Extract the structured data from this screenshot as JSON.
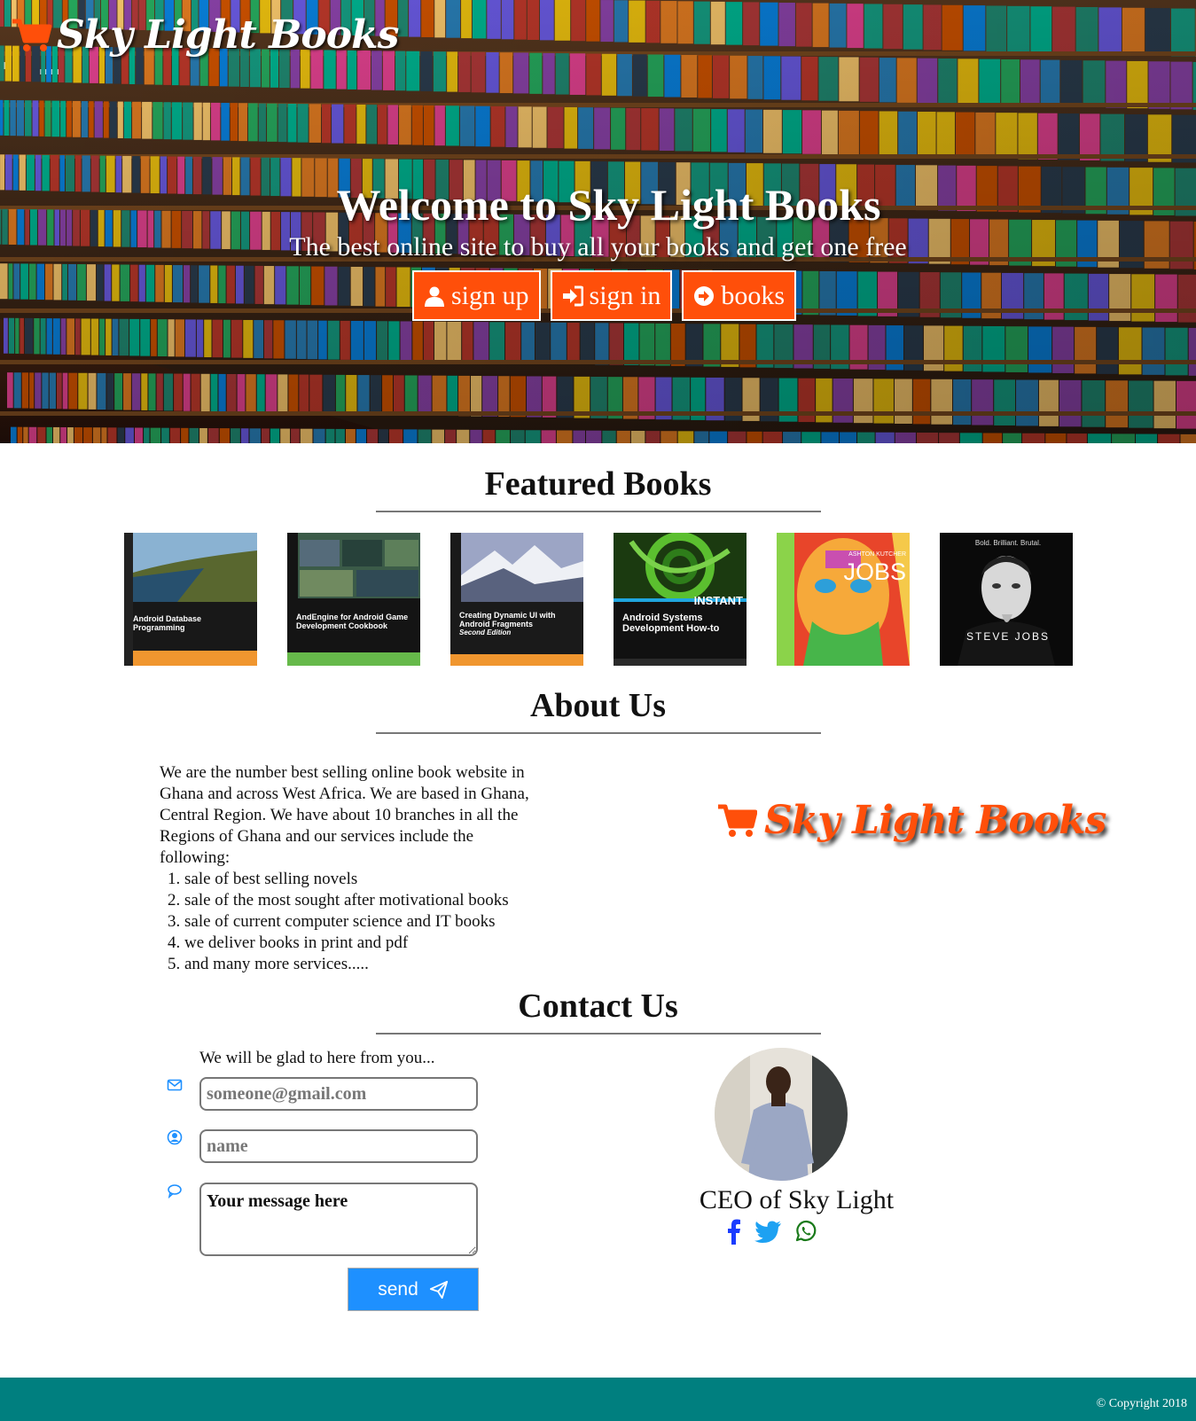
{
  "brand": {
    "name": "Sky Light Books",
    "accent": "#ff4f0a",
    "footer_color": "#007f7f"
  },
  "hero": {
    "title": "Welcome to Sky Light Books",
    "subtitle": "The best online site to buy all your books and get one free",
    "buttons": [
      {
        "label": "sign up",
        "icon": "user-icon"
      },
      {
        "label": "sign in",
        "icon": "sign-in-icon"
      },
      {
        "label": "books",
        "icon": "arrow-circle-right-icon"
      }
    ]
  },
  "featured": {
    "heading": "Featured Books",
    "books": [
      {
        "title": "Android Database Programming"
      },
      {
        "title": "AndEngine for Android Game Development Cookbook"
      },
      {
        "title": "Creating Dynamic UI with Android Fragments",
        "edition": "Second Edition"
      },
      {
        "title": "Android Systems Development How-to",
        "badge": "INSTANT"
      },
      {
        "title": "JOBS",
        "subtitle": "ASHTON KUTCHER"
      },
      {
        "title": "STEVE JOBS",
        "tagline": "Bold. Brilliant. Brutal."
      }
    ]
  },
  "about": {
    "heading": "About Us",
    "text": "We are the number best selling online book website in Ghana and across West Africa. We are based in Ghana, Central Region. We have about 10 branches in all the Regions of Ghana and our services include the following:",
    "services": [
      "sale of best selling novels",
      "sale of the most sought after motivational books",
      "sale of current computer science and IT books",
      "we deliver books in print and pdf",
      "and many more services....."
    ]
  },
  "contact": {
    "heading": "Contact Us",
    "intro": "We will be glad to here from you...",
    "email_placeholder": "someone@gmail.com",
    "name_placeholder": "name",
    "message_placeholder": "Your message here",
    "send_label": "send",
    "ceo_label": "CEO of Sky Light",
    "socials": [
      "facebook-icon",
      "twitter-icon",
      "whatsapp-icon"
    ]
  },
  "footer": {
    "copyright": "© Copyright 2018"
  }
}
